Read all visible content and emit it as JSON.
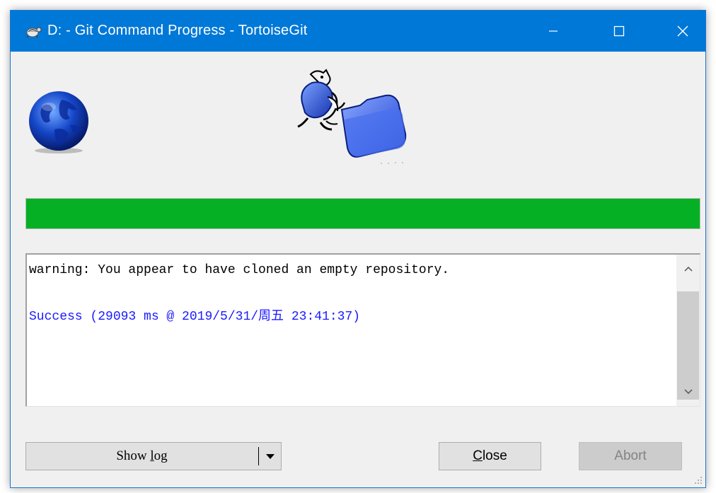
{
  "window": {
    "title": "D: - Git Command Progress - TortoiseGit",
    "title_icon": "tortoise-icon",
    "controls": {
      "minimize": "minimize-icon",
      "maximize": "maximize-icon",
      "close": "close-icon"
    }
  },
  "progress": {
    "fraction": 1.0,
    "color": "#06b025"
  },
  "log": {
    "lines": [
      {
        "text": "warning: You appear to have cloned an empty repository.",
        "color": "#000000"
      },
      {
        "text": "Success (29093 ms @ 2019/5/31/周五 23:41:37)",
        "color": "#1a1aff"
      }
    ]
  },
  "buttons": {
    "show_log_pre": "Show ",
    "show_log_underlined": "l",
    "show_log_post": "og",
    "close_underlined": "C",
    "close_rest": "lose",
    "abort": "Abort"
  },
  "colors": {
    "titlebar": "#0078d7",
    "dialog_bg": "#f0f0f0"
  }
}
